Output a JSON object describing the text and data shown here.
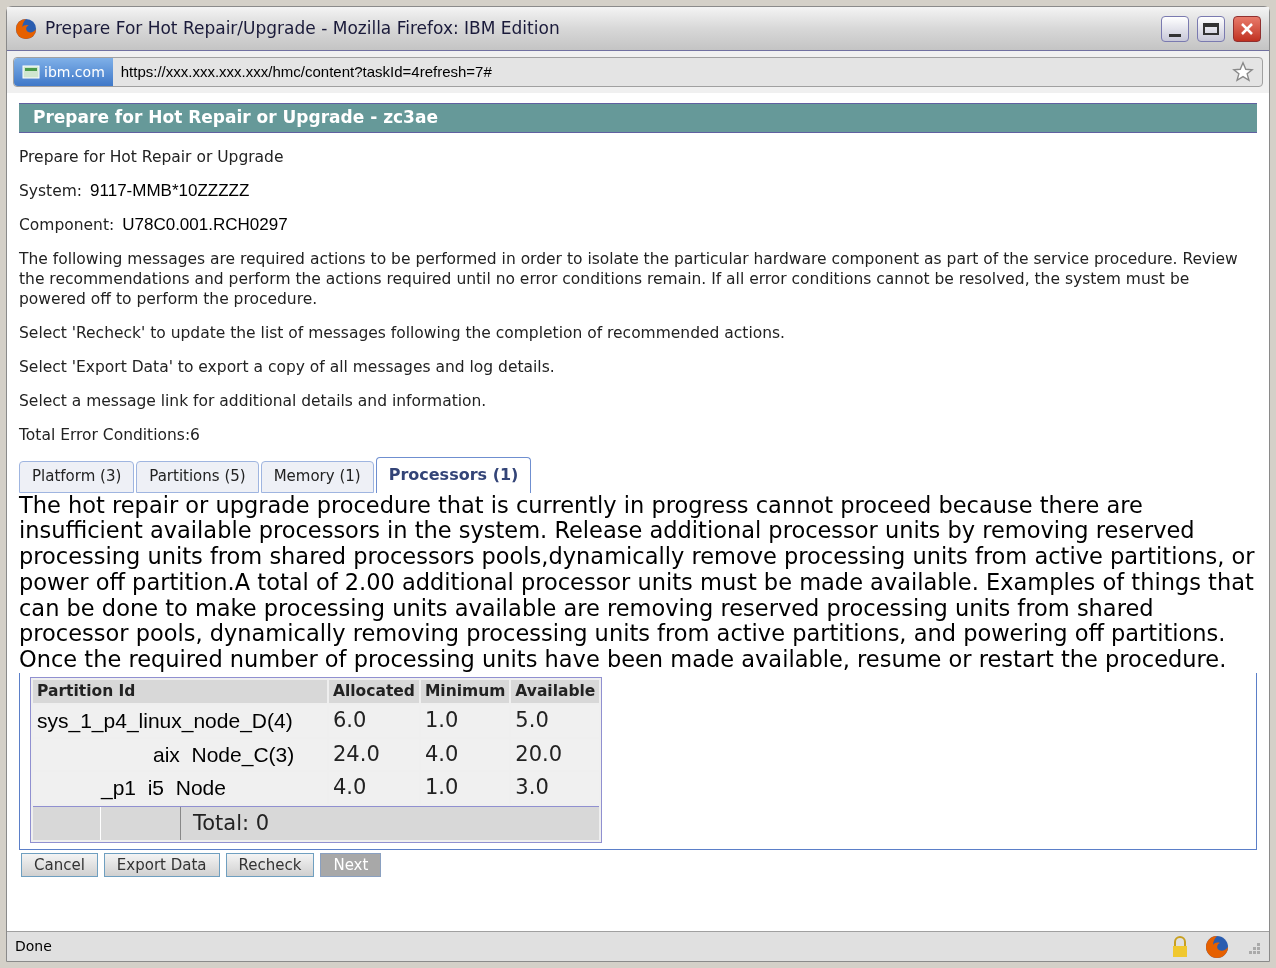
{
  "window": {
    "title": "Prepare For Hot Repair/Upgrade - Mozilla Firefox: IBM Edition"
  },
  "address_bar": {
    "site": "ibm.com",
    "url": "https://xxx.xxx.xxx.xxx/hmc/content?taskId=4refresh=7#"
  },
  "header": "Prepare for Hot Repair or Upgrade - zc3ae",
  "intro": [
    {
      "kind": "plain",
      "text": "Prepare for Hot Repair or Upgrade"
    },
    {
      "kind": "field",
      "label": "System:",
      "value": "9117-MMB*10ZZZZZ"
    },
    {
      "kind": "field",
      "label": "Component:",
      "value": "U78C0.001.RCH0297"
    },
    {
      "kind": "plain",
      "text": "The following messages are required actions to be performed in order to isolate the particular hardware component as part of the service procedure. Review the recommendations and perform the actions required until no error conditions remain. If all error conditions cannot be resolved, the system must be powered off to perform the procedure."
    },
    {
      "kind": "plain",
      "text": "Select 'Recheck' to update the list of messages following the completion of recommended actions."
    },
    {
      "kind": "plain",
      "text": "Select 'Export Data' to export a copy of all messages and log details."
    },
    {
      "kind": "plain",
      "text": "Select a message link for additional details and information."
    },
    {
      "kind": "plain",
      "text": "Total Error Conditions:6"
    }
  ],
  "tabs": [
    {
      "label": "Platform (3)",
      "selected": false
    },
    {
      "label": "Partitions (5)",
      "selected": false
    },
    {
      "label": "Memory (1)",
      "selected": false
    },
    {
      "label": "Processors (1)",
      "selected": true
    }
  ],
  "message": "The hot repair or upgrade procedure that is currently in progress cannot proceed because there are insufficient available processors in the system. Release additional processor units by removing reserved processing units from shared processors pools,dynamically remove processing units from active partitions, or power off partition.A total of 2.00 additional processor units must be made available. Examples of things that can be done to make processing units available are removing reserved processing units from shared processor pools, dynamically removing processing units from active partitions, and powering off partitions. Once the required number of processing units have been made available, resume or restart the procedure.",
  "table": {
    "columns": [
      "Partition Id",
      "Allocated",
      "Minimum",
      "Available"
    ],
    "rows": [
      [
        "sys_1_p4_linux_node_D(4)",
        "6.0",
        "1.0",
        "5.0"
      ],
      [
        "aix  Node_C(3)",
        "24.0",
        "4.0",
        "20.0"
      ],
      [
        "_p1  i5  Node",
        "4.0",
        "1.0",
        "3.0"
      ]
    ],
    "total": "Total: 0"
  },
  "buttons": [
    {
      "label": "Cancel",
      "disabled": false
    },
    {
      "label": "Export Data",
      "disabled": false
    },
    {
      "label": "Recheck",
      "disabled": false
    },
    {
      "label": "Next",
      "disabled": true
    }
  ],
  "status_bar": "Done"
}
